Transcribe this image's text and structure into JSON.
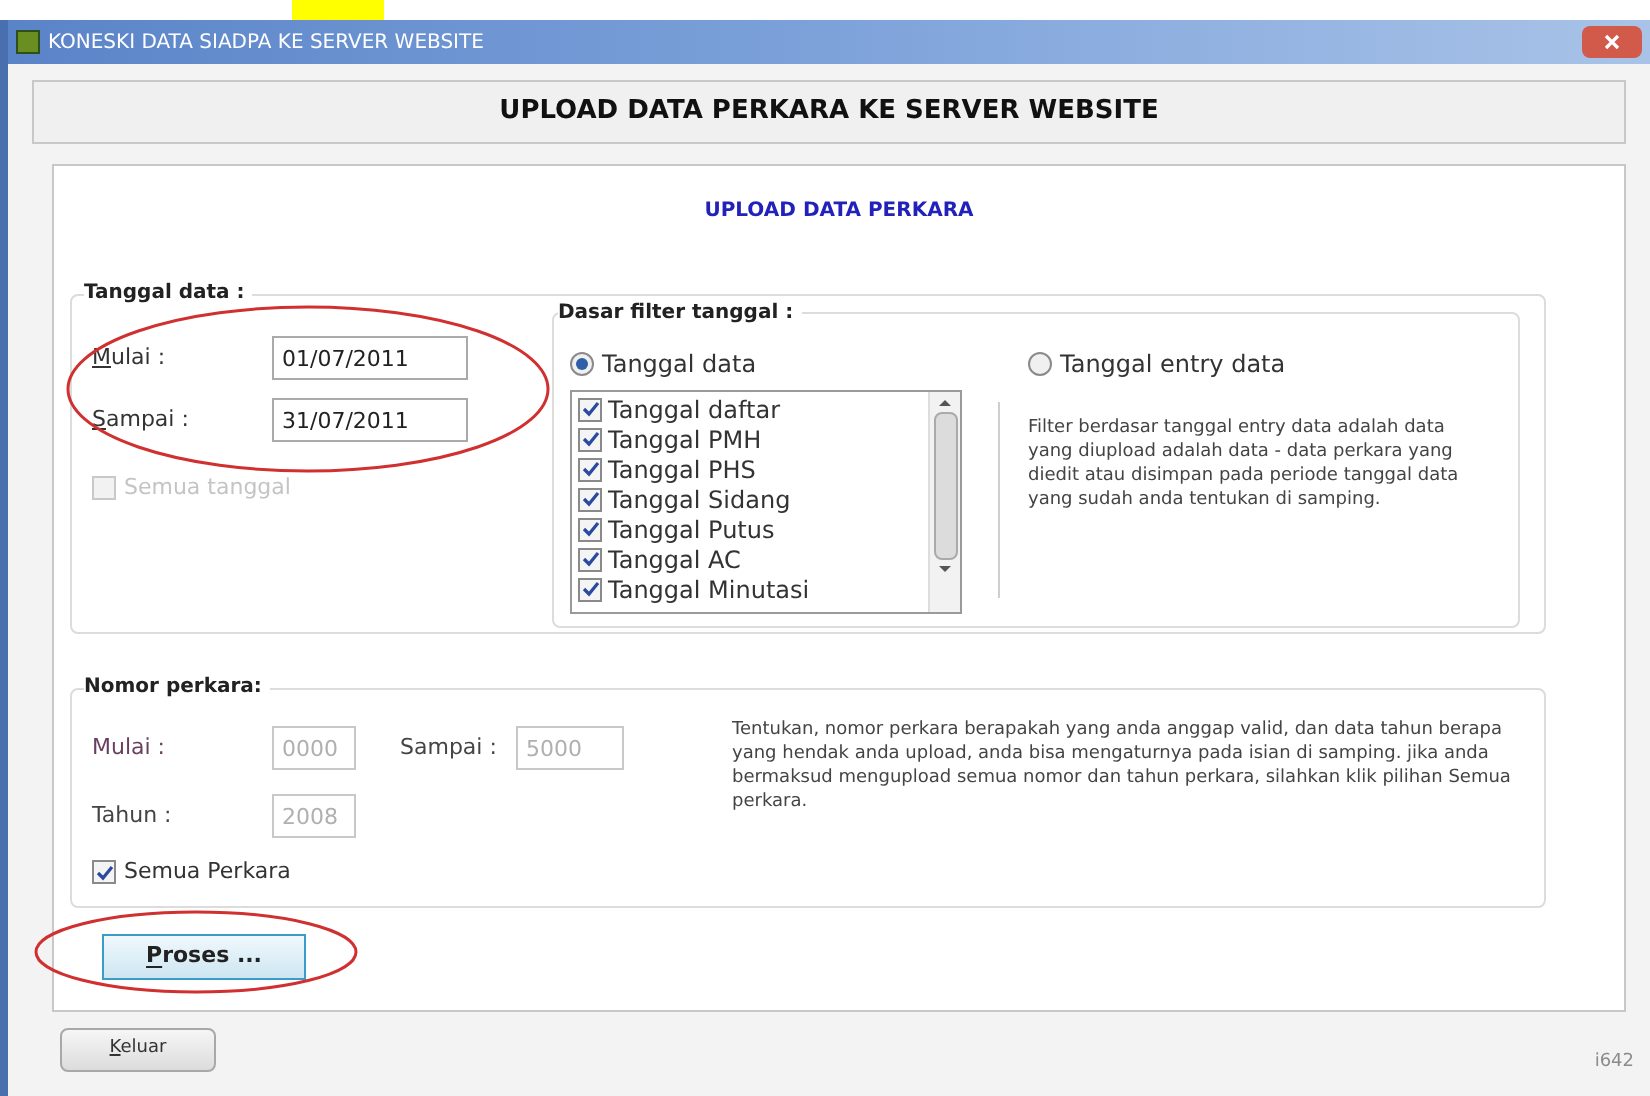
{
  "window": {
    "title": "KONESKI DATA SIADPA KE SERVER WEBSITE"
  },
  "header": "UPLOAD DATA PERKARA KE SERVER WEBSITE",
  "subtitle": "UPLOAD DATA PERKARA",
  "tanggal_data": {
    "legend": "Tanggal data :",
    "fields": [
      {
        "label": "Mulai :",
        "value": "01/07/2011"
      },
      {
        "label": "Sampai :",
        "value": "31/07/2011"
      }
    ],
    "semua_tanggal": {
      "label": "Semua tanggal",
      "checked": false,
      "disabled": true
    },
    "filter": {
      "legend": "Dasar filter tanggal :",
      "options": [
        {
          "label": "Tanggal data",
          "selected": true
        },
        {
          "label": "Tanggal entry data",
          "selected": false
        }
      ],
      "items": [
        {
          "label": "Tanggal daftar",
          "checked": true
        },
        {
          "label": "Tanggal PMH",
          "checked": true
        },
        {
          "label": "Tanggal PHS",
          "checked": true
        },
        {
          "label": "Tanggal Sidang",
          "checked": true
        },
        {
          "label": "Tanggal Putus",
          "checked": true
        },
        {
          "label": "Tanggal AC",
          "checked": true
        },
        {
          "label": "Tanggal Minutasi",
          "checked": true
        }
      ],
      "note": "Filter berdasar tanggal entry data adalah data yang diupload adalah data - data perkara yang diedit atau disimpan pada periode tanggal data yang sudah anda tentukan di samping."
    }
  },
  "nomor_perkara": {
    "legend": "Nomor perkara:",
    "mulai": {
      "label": "Mulai :",
      "value": "0000",
      "disabled": true
    },
    "sampai": {
      "label": "Sampai :",
      "value": "5000",
      "disabled": true
    },
    "tahun": {
      "label": "Tahun :",
      "value": "2008",
      "disabled": true
    },
    "semua_perkara": {
      "label": "Semua Perkara",
      "checked": true
    },
    "note": "Tentukan, nomor perkara berapakah yang anda anggap valid, dan data tahun berapa yang hendak anda upload, anda bisa mengaturnya pada isian di samping. jika anda bermaksud mengupload semua nomor dan tahun perkara, silahkan klik pilihan Semua perkara."
  },
  "buttons": [
    {
      "label": "Proses ..."
    },
    {
      "label": "Keluar"
    }
  ],
  "corner_text": "i642"
}
